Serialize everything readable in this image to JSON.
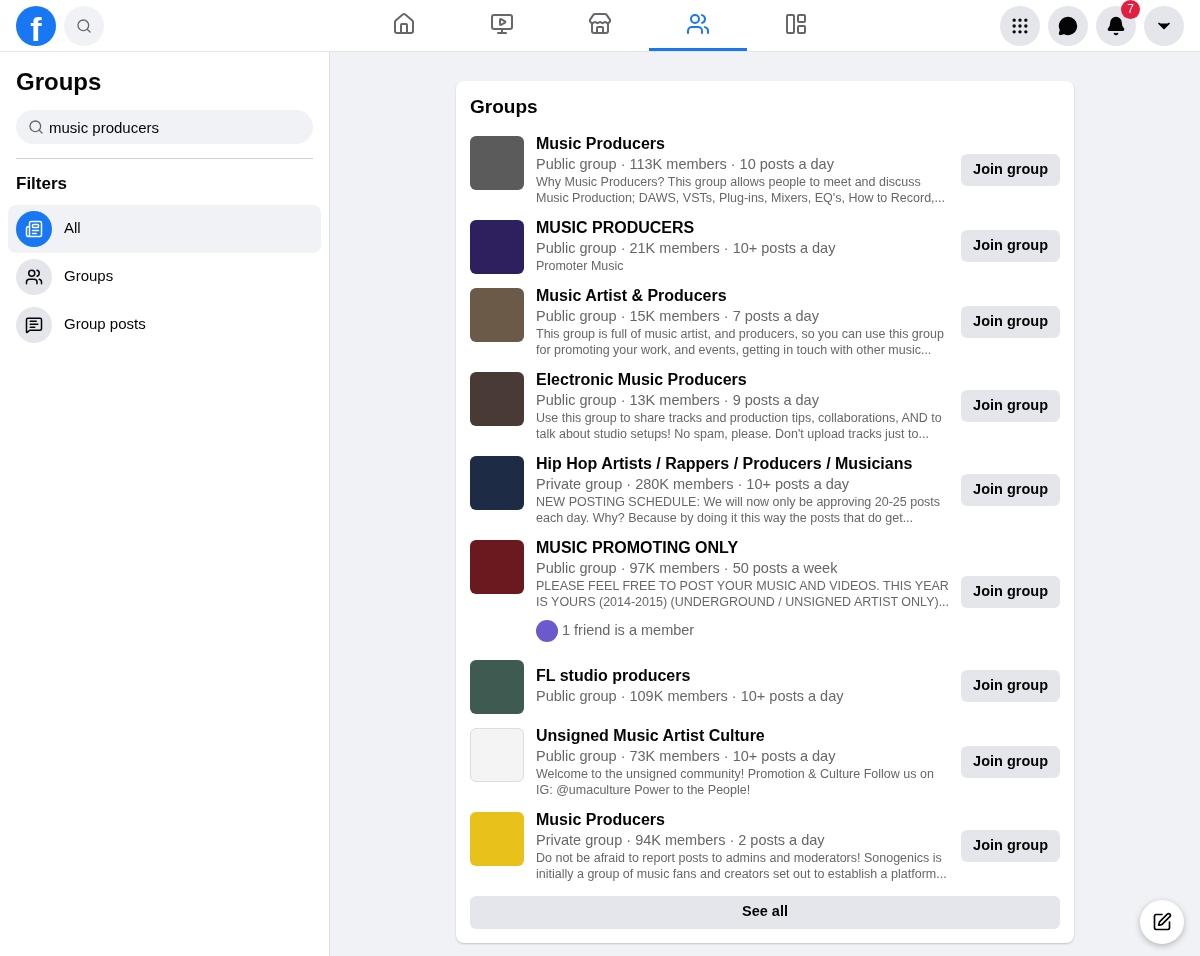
{
  "topbar": {
    "logo": "f",
    "nav": [
      {
        "kind": "home",
        "selected": false
      },
      {
        "kind": "video",
        "selected": false
      },
      {
        "kind": "marketplace",
        "selected": false
      },
      {
        "kind": "groups",
        "selected": true
      },
      {
        "kind": "gaming",
        "selected": false
      }
    ],
    "actions": [
      {
        "kind": "menu"
      },
      {
        "kind": "messenger"
      },
      {
        "kind": "notifications",
        "badge": "7"
      },
      {
        "kind": "account"
      }
    ]
  },
  "sidebar": {
    "title": "Groups",
    "search": {
      "value": "music producers"
    },
    "filters_title": "Filters",
    "filters": [
      {
        "kind": "all",
        "label": "All",
        "selected": true
      },
      {
        "kind": "groups",
        "label": "Groups",
        "selected": false
      },
      {
        "kind": "posts",
        "label": "Group posts",
        "selected": false
      }
    ]
  },
  "results": {
    "title": "Groups",
    "groups": [
      {
        "name": "Music Producers",
        "meta": "Public group · 113K members · 10 posts a day",
        "description": "Why Music Producers? This group allows people to meet and discuss Music Production; DAWS, VSTs, Plug-ins, Mixers, EQ's, How to Record,...",
        "button": "Join group"
      },
      {
        "name": "MUSIC PRODUCERS",
        "meta": "Public group · 21K members · 10+ posts a day",
        "description": "Promoter Music",
        "button": "Join group"
      },
      {
        "name": "Music Artist & Producers",
        "meta": "Public group · 15K members · 7 posts a day",
        "description": "This group is full of music artist, and producers, so you can use this group for promoting your work, and events, getting in touch with other music...",
        "button": "Join group"
      },
      {
        "name": "Electronic Music Producers",
        "meta": "Public group · 13K members · 9 posts a day",
        "description": "Use this group to share tracks and production tips, collaborations, AND to talk about studio setups! No spam, please. Don't upload tracks just to...",
        "button": "Join group"
      },
      {
        "name": "Hip Hop Artists / Rappers / Producers / Musicians",
        "meta": "Private group · 280K members · 10+ posts a day",
        "description": "NEW POSTING SCHEDULE: We will now only be approving 20-25 posts each day. Why? Because by doing it this way the posts that do get...",
        "button": "Join group"
      },
      {
        "name": "MUSIC PROMOTING ONLY",
        "meta": "Public group · 97K members · 50 posts a week",
        "description": "PLEASE FEEL FREE TO POST YOUR MUSIC AND VIDEOS. THIS YEAR IS YOURS (2014-2015) (UNDERGROUND / UNSIGNED ARTIST ONLY)...",
        "friends": "1 friend is a member",
        "button": "Join group"
      },
      {
        "name": "FL studio producers",
        "meta": "Public group · 109K members · 10+ posts a day",
        "button": "Join group"
      },
      {
        "name": "Unsigned Music Artist Culture",
        "meta": "Public group · 73K members · 10+ posts a day",
        "description": "Welcome to the unsigned community! Promotion & Culture Follow us on IG: @umaculture Power to the People!",
        "button": "Join group"
      },
      {
        "name": "Music Producers",
        "meta": "Private group · 94K members · 2 posts a day",
        "description": "Do not be afraid to report posts to admins and moderators! Sonogenics is initially a group of music fans and creators set out to establish a platform...",
        "button": "Join group"
      }
    ],
    "see_all": "See all"
  }
}
